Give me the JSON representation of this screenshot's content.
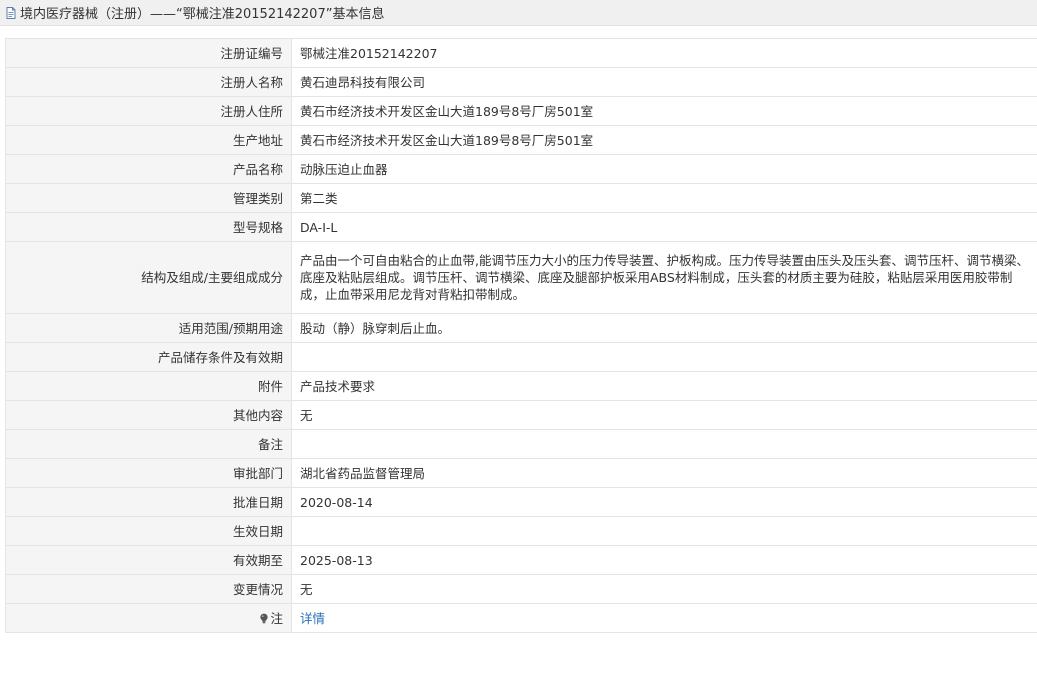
{
  "header": {
    "title": "境内医疗器械（注册）——“鄂械注准20152142207”基本信息",
    "icon": "document-icon"
  },
  "rows": [
    {
      "label": "注册证编号",
      "value": "鄂械注准20152142207"
    },
    {
      "label": "注册人名称",
      "value": "黄石迪昂科技有限公司"
    },
    {
      "label": "注册人住所",
      "value": "黄石市经济技术开发区金山大道189号8号厂房501室"
    },
    {
      "label": "生产地址",
      "value": "黄石市经济技术开发区金山大道189号8号厂房501室"
    },
    {
      "label": "产品名称",
      "value": "动脉压迫止血器"
    },
    {
      "label": "管理类别",
      "value": "第二类"
    },
    {
      "label": "型号规格",
      "value": "DA-I-L"
    },
    {
      "label": "结构及组成/主要组成成分",
      "value": "产品由一个可自由粘合的止血带,能调节压力大小的压力传导装置、护板构成。压力传导装置由压头及压头套、调节压杆、调节横梁、底座及粘贴层组成。调节压杆、调节横梁、底座及腿部护板采用ABS材料制成，压头套的材质主要为硅胶，粘贴层采用医用胶带制成，止血带采用尼龙背对背粘扣带制成。"
    },
    {
      "label": "适用范围/预期用途",
      "value": "股动（静）脉穿刺后止血。"
    },
    {
      "label": "产品储存条件及有效期",
      "value": ""
    },
    {
      "label": "附件",
      "value": "产品技术要求"
    },
    {
      "label": "其他内容",
      "value": "无"
    },
    {
      "label": "备注",
      "value": ""
    },
    {
      "label": "审批部门",
      "value": "湖北省药品监督管理局"
    },
    {
      "label": "批准日期",
      "value": "2020-08-14"
    },
    {
      "label": "生效日期",
      "value": ""
    },
    {
      "label": "有效期至",
      "value": "2025-08-13"
    },
    {
      "label": "变更情况",
      "value": "无"
    }
  ],
  "note_row": {
    "label": "注",
    "link_text": "详情",
    "icon": "lightbulb-icon"
  },
  "colors": {
    "label_bg": "#f5f5f5",
    "border": "#e4e4e4",
    "link": "#2a6fb8",
    "title_bg": "#f0f0f0"
  }
}
